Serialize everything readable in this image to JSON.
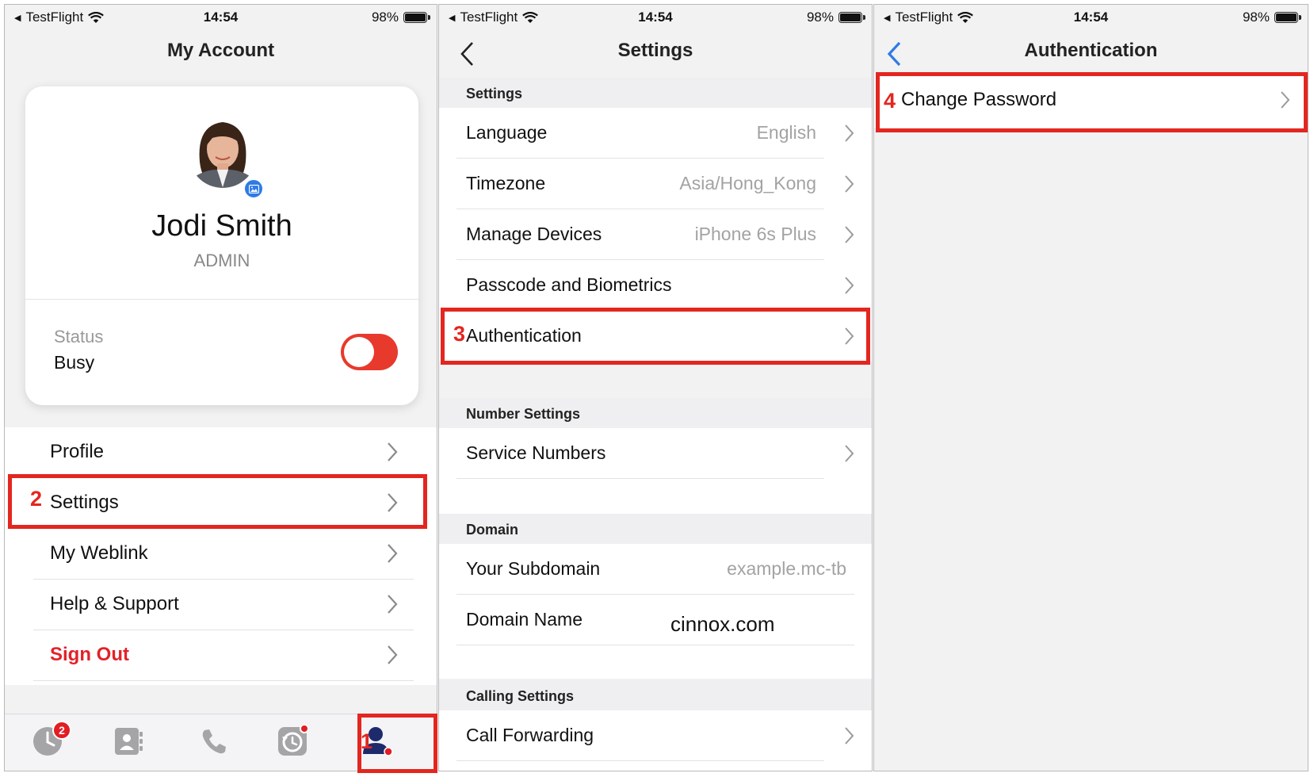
{
  "status_bar": {
    "carrier": "TestFlight",
    "time": "14:54",
    "battery": "98%"
  },
  "panel1": {
    "title": "My Account",
    "profile": {
      "name": "Jodi Smith",
      "role": "ADMIN",
      "status_label": "Status",
      "status_value": "Busy",
      "status_toggle_on": true
    },
    "menu": [
      {
        "label": "Profile"
      },
      {
        "label": "Settings"
      },
      {
        "label": "My Weblink"
      },
      {
        "label": "Help & Support"
      },
      {
        "label": "Sign Out"
      }
    ],
    "tabbar": {
      "recent_badge": "2",
      "tabs": [
        "clock-icon",
        "contacts-icon",
        "phone-icon",
        "history-icon",
        "account-icon"
      ]
    }
  },
  "panel2": {
    "title": "Settings",
    "sections": {
      "settings": {
        "header": "Settings",
        "rows": [
          {
            "label": "Language",
            "value": "English"
          },
          {
            "label": "Timezone",
            "value": "Asia/Hong_Kong"
          },
          {
            "label": "Manage Devices",
            "value": "iPhone 6s Plus"
          },
          {
            "label": "Passcode and Biometrics",
            "value": ""
          },
          {
            "label": "Authentication",
            "value": ""
          }
        ]
      },
      "number": {
        "header": "Number Settings",
        "rows": [
          {
            "label": "Service Numbers"
          }
        ]
      },
      "domain": {
        "header": "Domain",
        "rows": [
          {
            "label": "Your Subdomain",
            "value": "example.mc-tb"
          },
          {
            "label": "Domain Name",
            "value": "cinnox.com"
          }
        ]
      },
      "calling": {
        "header": "Calling Settings",
        "rows": [
          {
            "label": "Call Forwarding"
          }
        ]
      }
    }
  },
  "panel3": {
    "title": "Authentication",
    "rows": [
      {
        "label": "Change Password"
      }
    ]
  },
  "annotations": {
    "steps": [
      "1",
      "2",
      "3",
      "4"
    ],
    "highlight_color": "#e3261f"
  },
  "colors": {
    "accent_blue": "#2f7be5",
    "danger_red": "#e32129",
    "toggle_red": "#e8392d"
  }
}
